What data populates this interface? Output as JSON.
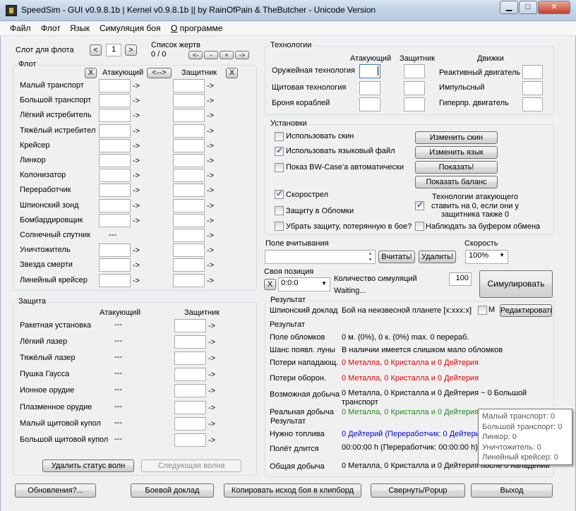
{
  "window": {
    "title": "SpeedSim - GUI v0.9.8.1b | Kernel v0.9.8.1b  ||  by RainOfPain & TheButcher - Unicode Version",
    "minimize": "▁",
    "maximize": "□",
    "close": "✕"
  },
  "menu": {
    "file": "Файл",
    "fleet": "Флот",
    "language": "Язык",
    "simulation": "Симуляция боя",
    "about_first": "О",
    "about_rest": " программе"
  },
  "slot": {
    "label": "Слот для флота",
    "prev": "<",
    "value": "1",
    "next": ">",
    "victims_label": "Список жертв",
    "victims_count": "0 / 0",
    "vprev": "<-",
    "vminus": "-",
    "vplus": "+",
    "vnext": "->"
  },
  "fleet": {
    "title": "Флот",
    "clear_att": "X",
    "attacker": "Атакующий",
    "swap": "<-->",
    "defender": "Защитник",
    "clear_def": "X",
    "arrow": "->",
    "no_field": "---",
    "ships": [
      "Малый транспорт",
      "Большой транспорт",
      "Лёгкий истребитель",
      "Тяжёлый истребител",
      "Крейсер",
      "Линкор",
      "Колонизатор",
      "Переработчик",
      "Шпионский зонд",
      "Бомбардировщик",
      "Солнечный спутник",
      "Уничтожитель",
      "Звезда смерти",
      "Линейный крейсер"
    ]
  },
  "defense": {
    "title": "Защита",
    "attacker": "Атакующий",
    "defender": "Защитник",
    "arrow": "->",
    "none": "---",
    "items": [
      "Ракетная установка",
      "Лёгкий лазер",
      "Тяжёлый лазер",
      "Пушка Гаусса",
      "Ионное орудие",
      "Плазменное орудие",
      "Малый щитовой купол",
      "Большой щитовой купол"
    ],
    "delete_wave": "Удалить статус волн",
    "next_wave": "Следующая волна"
  },
  "tech": {
    "title": "Технологии",
    "attacker": "Атакующий",
    "defender": "Защитник",
    "engines": "Движки",
    "weapons": "Оружейная технология",
    "shields": "Щитовая технология",
    "armor": "Броня кораблей",
    "combustion": "Реактивный двигатель",
    "impulse": "Импульсный",
    "hyperspace": "Гиперпр. двигатель"
  },
  "settings": {
    "title": "Установки",
    "use_skin": "Использовать скин",
    "use_lang": "Использовать языковый файл",
    "show_bw": "Показ BW-Case'a  автоматически",
    "rapidfire": "Скорострел",
    "def_to_debris": "Защиту в Обломки",
    "remove_def": "Убрать защиту, потерянную в бое?",
    "tech_zero": "Технологии атакующего ставить на 0, если они у защитника также 0",
    "monitor_clip": "Наблюдать за буфером обмена",
    "change_skin": "Изменить скин",
    "change_lang": "Изменить язык",
    "show": "Показать!",
    "show_balance": "Показать баланс"
  },
  "read": {
    "label": "Поле вчитывания",
    "read_btn": "Вчитать!",
    "delete_btn": "Удалить!",
    "speed_label": "Скорость",
    "speed_value": "100%"
  },
  "position": {
    "label": "Своя позиция",
    "clear": "X",
    "value": "0:0:0",
    "sim_count_label": "Количество симуляций",
    "sim_count": "100",
    "status": "Waiting...",
    "simulate": "Симулировать"
  },
  "result": {
    "title": "Результат",
    "spy_label": "Шпионский доклад",
    "spy_value": "Бой на неизвесной планете [x:xxx:x]",
    "m": "M",
    "edit": "Редактировать",
    "result_label": "Результат",
    "debris_label": "Поле обломков",
    "debris_value": "0 м. (0%), 0 к. (0%) max. 0 перераб.",
    "moon_label": "Шанс появл. луны",
    "moon_value": "В наличии имеется слишком мало обломков",
    "att_loss_label": "Потери нападающ.",
    "att_loss_value": "0 Металла, 0 Кристалла и 0 Дейтерия",
    "def_loss_label": "Потери оборон.",
    "def_loss_value": "0 Металла, 0 Кристалла и 0 Дейтерия",
    "poss_plunder_label": "Возможная добыча",
    "poss_plunder_value": "0 Металла, 0 Кристалла и 0 Дейтерия ~ 0 Большой",
    "poss_plunder_value2": "транспорт",
    "real_plunder_label": "Реальная добыча",
    "real_plunder_value": "0 Металла, 0 Кристалла и 0 Дейтерия",
    "result_label2": "Результат",
    "fuel_label": "Нужно топлива",
    "fuel_value": "0 Дейтерий (Переработчик: 0 Дейтерий",
    "flight_label": "Полёт длится",
    "flight_value": "00:00:00 h (Переработчик: 00:00:00 h)",
    "total_label": "Общая добыча",
    "total_value": "0 Металла, 0 Кристалла и 0 Дейтерия после 0 нападении"
  },
  "tooltip": [
    "Малый транспорт: 0",
    "Большой транспорт: 0",
    "Линкор: 0",
    "Уничтожитель: 0",
    "Линейный крейсер: 0"
  ],
  "bottom": {
    "updates": "Обновления?...",
    "battle_report": "Боевой доклад",
    "copy_source": "Копировать исход боя в клипборд",
    "minimize_popup": "Свернуть/Popup",
    "exit": "Выход"
  }
}
